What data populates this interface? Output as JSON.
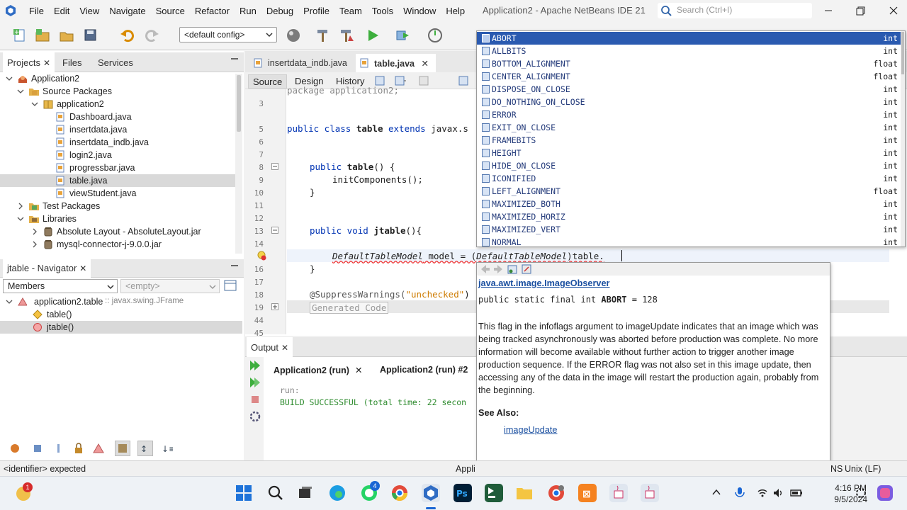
{
  "window": {
    "title": "Application2 - Apache NetBeans IDE 21",
    "menu": [
      "File",
      "Edit",
      "View",
      "Navigate",
      "Source",
      "Refactor",
      "Run",
      "Debug",
      "Profile",
      "Team",
      "Tools",
      "Window",
      "Help"
    ],
    "search_placeholder": "Search (Ctrl+I)"
  },
  "toolbar": {
    "config_value": "<default config>"
  },
  "projects_panel": {
    "tabs": [
      "Projects",
      "Files",
      "Services"
    ],
    "tree": [
      {
        "label": "Application2",
        "icon": "project-icon"
      },
      {
        "label": "Source Packages",
        "icon": "source-folder-icon"
      },
      {
        "label": "application2",
        "icon": "package-icon"
      },
      {
        "label": "Dashboard.java",
        "icon": "java-file-icon"
      },
      {
        "label": "insertdata.java",
        "icon": "java-file-icon"
      },
      {
        "label": "insertdata_indb.java",
        "icon": "java-file-icon"
      },
      {
        "label": "login2.java",
        "icon": "java-file-icon"
      },
      {
        "label": "progressbar.java",
        "icon": "java-file-icon"
      },
      {
        "label": "table.java",
        "icon": "java-file-icon"
      },
      {
        "label": "viewStudent.java",
        "icon": "java-file-icon"
      },
      {
        "label": "Test Packages",
        "icon": "test-folder-icon"
      },
      {
        "label": "Libraries",
        "icon": "library-icon"
      },
      {
        "label": "Absolute Layout - AbsoluteLayout.jar",
        "icon": "jar-icon"
      },
      {
        "label": "mysql-connector-j-9.0.0.jar",
        "icon": "jar-icon"
      }
    ]
  },
  "navigator": {
    "title": "jtable - Navigator",
    "filter": "Members",
    "empty": "<empty>",
    "class_label": "application2.table",
    "class_super": ":: javax.swing.JFrame",
    "members": [
      "table()",
      "jtable()"
    ]
  },
  "editor": {
    "tabs": [
      "insertdata_indb.java",
      "table.java"
    ],
    "modes": [
      "Source",
      "Design",
      "History"
    ],
    "lines": [
      {
        "n": "",
        "text": "package application2;"
      },
      {
        "n": "3",
        "text": ""
      },
      {
        "n": "5",
        "text": "public class table extends javax.s"
      },
      {
        "n": "6",
        "text": ""
      },
      {
        "n": "7",
        "text": ""
      },
      {
        "n": "8",
        "text": "public table() {"
      },
      {
        "n": "9",
        "text": "initComponents();"
      },
      {
        "n": "10",
        "text": "}"
      },
      {
        "n": "11",
        "text": ""
      },
      {
        "n": "12",
        "text": ""
      },
      {
        "n": "13",
        "text": "public void jtable(){"
      },
      {
        "n": "14",
        "text": ""
      },
      {
        "n": "15",
        "text": "DefaultTableModel model = (DefaultTableModel)table."
      },
      {
        "n": "16",
        "text": "}"
      },
      {
        "n": "17",
        "text": ""
      },
      {
        "n": "18",
        "text": "@SuppressWarnings(\"unchecked\")"
      },
      {
        "n": "19",
        "text": "Generated Code"
      },
      {
        "n": "44",
        "text": ""
      },
      {
        "n": "45",
        "text": ""
      }
    ]
  },
  "output": {
    "title": "Output",
    "tabs": [
      "Application2 (run)",
      "Application2 (run) #2"
    ],
    "lines": [
      "run:",
      "BUILD SUCCESSFUL (total time: 22 secon"
    ]
  },
  "completion": {
    "items": [
      {
        "name": "ABORT",
        "type": "int"
      },
      {
        "name": "ALLBITS",
        "type": "int"
      },
      {
        "name": "BOTTOM_ALIGNMENT",
        "type": "float"
      },
      {
        "name": "CENTER_ALIGNMENT",
        "type": "float"
      },
      {
        "name": "DISPOSE_ON_CLOSE",
        "type": "int"
      },
      {
        "name": "DO_NOTHING_ON_CLOSE",
        "type": "int"
      },
      {
        "name": "ERROR",
        "type": "int"
      },
      {
        "name": "EXIT_ON_CLOSE",
        "type": "int"
      },
      {
        "name": "FRAMEBITS",
        "type": "int"
      },
      {
        "name": "HEIGHT",
        "type": "int"
      },
      {
        "name": "HIDE_ON_CLOSE",
        "type": "int"
      },
      {
        "name": "ICONIFIED",
        "type": "int"
      },
      {
        "name": "LEFT_ALIGNMENT",
        "type": "float"
      },
      {
        "name": "MAXIMIZED_BOTH",
        "type": "int"
      },
      {
        "name": "MAXIMIZED_HORIZ",
        "type": "int"
      },
      {
        "name": "MAXIMIZED_VERT",
        "type": "int"
      },
      {
        "name": "NORMAL",
        "type": "int"
      }
    ]
  },
  "javadoc": {
    "class": "java.awt.image.ImageObserver",
    "signature_pre": "public static final int ",
    "signature_name": "ABORT",
    "signature_post": " = 128",
    "description": "This flag in the infoflags argument to imageUpdate indicates that an image which was being tracked asynchronously was aborted before production was complete. No more information will become available without further action to trigger another image production sequence. If the ERROR flag was not also set in this image update, then accessing any of the data in the image will restart the production again, probably from the beginning.",
    "see_also_label": "See Also:",
    "see_also_link": "imageUpdate"
  },
  "statusbar": {
    "message": "<identifier> expected",
    "app": "Appli",
    "encoding": "NS",
    "line_endings": "Unix (LF)"
  },
  "taskbar": {
    "time": "4:16 PM",
    "date": "9/5/2024",
    "notification_count": "1",
    "whatsapp_badge": "4"
  },
  "colors": {
    "selection": "#2a5ab0",
    "keyword": "#0033b3",
    "string": "#ce7b00",
    "link": "#1a4fa0"
  }
}
